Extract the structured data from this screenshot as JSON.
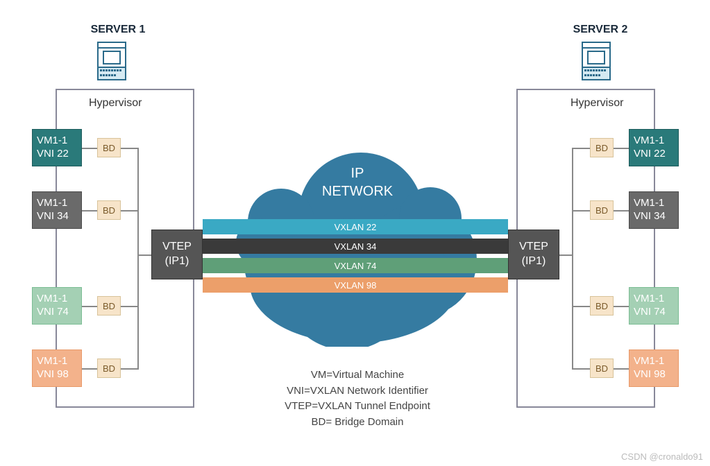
{
  "server1": {
    "title": "SERVER 1",
    "hypervisor": "Hypervisor",
    "vtep": {
      "name": "VTEP",
      "ip": "(IP1)"
    },
    "bd_label": "BD",
    "vms": [
      {
        "name": "VM1-1",
        "vni": "VNI 22",
        "color": "teal"
      },
      {
        "name": "VM1-1",
        "vni": "VNI 34",
        "color": "gray"
      },
      {
        "name": "VM1-1",
        "vni": "VNI 74",
        "color": "green"
      },
      {
        "name": "VM1-1",
        "vni": "VNI 98",
        "color": "orange"
      }
    ]
  },
  "server2": {
    "title": "SERVER 2",
    "hypervisor": "Hypervisor",
    "vtep": {
      "name": "VTEP",
      "ip": "(IP1)"
    },
    "bd_label": "BD",
    "vms": [
      {
        "name": "VM1-1",
        "vni": "VNI 22",
        "color": "teal"
      },
      {
        "name": "VM1-1",
        "vni": "VNI 34",
        "color": "gray"
      },
      {
        "name": "VM1-1",
        "vni": "VNI 74",
        "color": "green"
      },
      {
        "name": "VM1-1",
        "vni": "VNI 98",
        "color": "orange"
      }
    ]
  },
  "cloud": {
    "title_line1": "IP",
    "title_line2": "NETWORK",
    "tunnels": [
      {
        "label": "VXLAN 22",
        "color": "teal"
      },
      {
        "label": "VXLAN 34",
        "color": "gray"
      },
      {
        "label": "VXLAN 74",
        "color": "green"
      },
      {
        "label": "VXLAN 98",
        "color": "orange"
      }
    ]
  },
  "legend": {
    "l1": "VM=Virtual Machine",
    "l2": "VNI=VXLAN Network Identifier",
    "l3": "VTEP=VXLAN Tunnel Endpoint",
    "l4": "BD= Bridge Domain"
  },
  "watermark": "CSDN @cronaldo91"
}
